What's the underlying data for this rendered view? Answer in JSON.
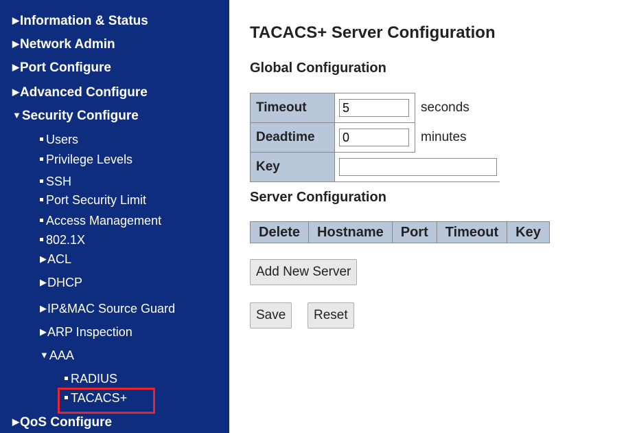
{
  "sidebar": {
    "information_status": "Information & Status",
    "network_admin": "Network Admin",
    "port_configure": "Port Configure",
    "advanced_configure": "Advanced Configure",
    "security_configure": "Security Configure",
    "users": "Users",
    "privilege_levels": "Privilege Levels",
    "ssh": "SSH",
    "port_security_limit": "Port Security Limit",
    "access_management": "Access Management",
    "dot1x": "802.1X",
    "acl": "ACL",
    "dhcp": "DHCP",
    "ip_mac_source_guard": "IP&MAC Source Guard",
    "arp_inspection": "ARP Inspection",
    "aaa": "AAA",
    "radius": "RADIUS",
    "tacacs": "TACACS+",
    "qos_configure": "QoS Configure",
    "selected_highlight_color": "#e8252e",
    "background_color": "#0f2d7e"
  },
  "main": {
    "title": "TACACS+ Server Configuration",
    "global_title": "Global Configuration",
    "global": {
      "timeout_label": "Timeout",
      "timeout_value": "5",
      "timeout_unit": "seconds",
      "deadtime_label": "Deadtime",
      "deadtime_value": "0",
      "deadtime_unit": "minutes",
      "key_label": "Key",
      "key_value": ""
    },
    "server_title": "Server Configuration",
    "server_columns": [
      "Delete",
      "Hostname",
      "Port",
      "Timeout",
      "Key"
    ],
    "add_server_label": "Add New Server",
    "save_label": "Save",
    "reset_label": "Reset"
  }
}
